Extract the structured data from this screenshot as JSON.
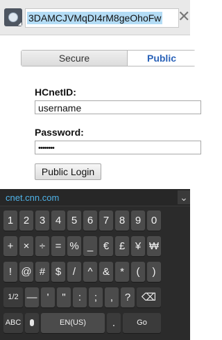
{
  "browser": {
    "url": "3DAMCJVMqDI4rM8geOhoFw",
    "clear_glyph": "✕",
    "site_icon": "globe-icon"
  },
  "login": {
    "tab_secure": "Secure",
    "tab_public": "Public",
    "hcnetid_label": "HCnetID:",
    "username_value": "username",
    "password_label": "Password:",
    "password_value": "••••••••",
    "login_button": "Public Login"
  },
  "keyboard": {
    "suggestion": "cnet.cnn.com",
    "row1": [
      "1",
      "2",
      "3",
      "4",
      "5",
      "6",
      "7",
      "8",
      "9",
      "0"
    ],
    "row2": [
      "+",
      "×",
      "÷",
      "=",
      "%",
      "_",
      "€",
      "£",
      "¥",
      "₩"
    ],
    "row3": [
      "!",
      "@",
      "#",
      "$",
      "/",
      "^",
      "&",
      "*",
      "(",
      ")"
    ],
    "row4": [
      "1/2",
      "—",
      "'",
      "\"",
      ":",
      ";",
      ",",
      "?",
      "⌫"
    ],
    "row5": {
      "abc": "ABC",
      "lang": "EN(US)",
      "dot": ".",
      "go": "Go"
    }
  }
}
